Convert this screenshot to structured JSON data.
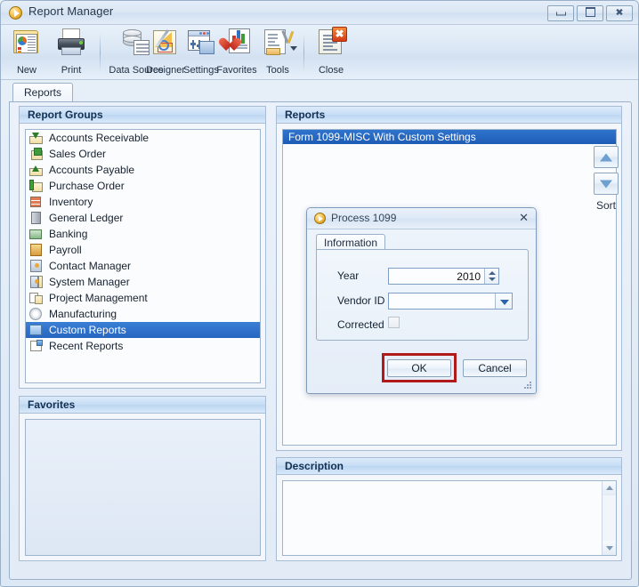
{
  "window": {
    "title": "Report Manager",
    "icon": "app-play-icon",
    "buttons": {
      "minimize": "minimize-icon",
      "maximize": "maximize-icon",
      "close": "close-icon",
      "close_glyph": "✖"
    }
  },
  "toolbar": {
    "items": [
      {
        "label": "New",
        "icon": "new-report-icon"
      },
      {
        "label": "Print",
        "icon": "printer-icon"
      },
      {
        "label": "Data Source",
        "icon": "database-icon"
      },
      {
        "label": "Designer",
        "icon": "designer-icon"
      },
      {
        "label": "Settings",
        "icon": "settings-icon"
      },
      {
        "label": "Favorites",
        "icon": "favorites-heart-icon"
      },
      {
        "label": "Tools",
        "icon": "tools-icon"
      },
      {
        "label": "Close",
        "icon": "close-document-icon"
      }
    ],
    "tools_dropdown": "chevron-down-icon"
  },
  "tabs": [
    {
      "label": "Reports",
      "selected": true
    }
  ],
  "report_groups": {
    "header": "Report Groups",
    "items": [
      {
        "label": "Accounts Receivable",
        "icon": "accounts-receivable-icon",
        "selected": false
      },
      {
        "label": "Sales Order",
        "icon": "sales-order-icon",
        "selected": false
      },
      {
        "label": "Accounts Payable",
        "icon": "accounts-payable-icon",
        "selected": false
      },
      {
        "label": "Purchase Order",
        "icon": "purchase-order-icon",
        "selected": false
      },
      {
        "label": "Inventory",
        "icon": "inventory-icon",
        "selected": false
      },
      {
        "label": "General Ledger",
        "icon": "general-ledger-icon",
        "selected": false
      },
      {
        "label": "Banking",
        "icon": "banking-icon",
        "selected": false
      },
      {
        "label": "Payroll",
        "icon": "payroll-icon",
        "selected": false
      },
      {
        "label": "Contact Manager",
        "icon": "contact-manager-icon",
        "selected": false
      },
      {
        "label": "System Manager",
        "icon": "system-manager-icon",
        "selected": false
      },
      {
        "label": "Project Management",
        "icon": "project-management-icon",
        "selected": false
      },
      {
        "label": "Manufacturing",
        "icon": "manufacturing-icon",
        "selected": false
      },
      {
        "label": "Custom Reports",
        "icon": "custom-reports-icon",
        "selected": true
      },
      {
        "label": "Recent Reports",
        "icon": "recent-reports-icon",
        "selected": false
      }
    ]
  },
  "favorites": {
    "header": "Favorites",
    "items": []
  },
  "reports": {
    "header": "Reports",
    "items": [
      {
        "label": "Form 1099-MISC With Custom Settings",
        "selected": true
      }
    ],
    "sort": {
      "label": "Sort",
      "up_icon": "sort-ascending-icon",
      "down_icon": "sort-descending-icon"
    }
  },
  "description": {
    "header": "Description",
    "text": "",
    "scrollbar": {
      "up_icon": "scroll-up-icon",
      "down_icon": "scroll-down-icon"
    }
  },
  "dialog": {
    "title": "Process 1099",
    "icon": "app-play-icon",
    "close_glyph": "✕",
    "tabs": [
      {
        "label": "Information",
        "selected": true
      }
    ],
    "fields": {
      "year": {
        "label": "Year",
        "value": "2010",
        "spinner": "spinner-icon"
      },
      "vendor_id": {
        "label": "Vendor ID",
        "value": "",
        "dropdown_icon": "chevron-down-icon"
      },
      "corrected": {
        "label": "Corrected",
        "checked": false
      }
    },
    "buttons": {
      "ok": "OK",
      "cancel": "Cancel"
    },
    "highlight_color": "#b01a1a",
    "resize_grip": "resize-grip-icon"
  },
  "colors": {
    "selection_blue": "#2666c0",
    "panel_header": "#c6ddf4",
    "window_border": "#9ab0c8",
    "highlight_red": "#b01a1a"
  }
}
